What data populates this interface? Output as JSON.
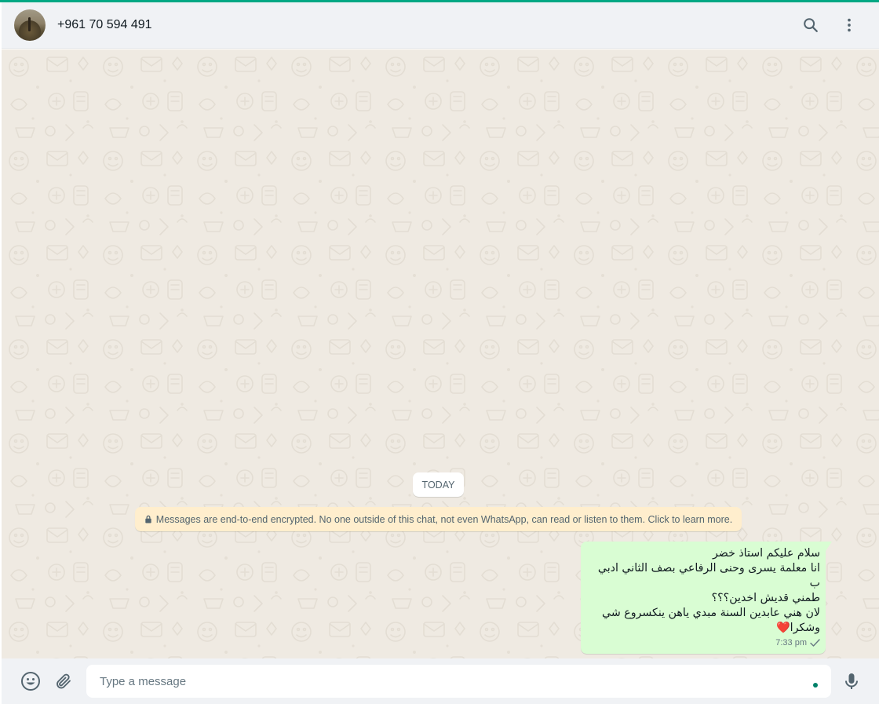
{
  "header": {
    "contact_name": "+961 70 594 491",
    "search_icon": "search-icon",
    "menu_icon": "more-vertical-icon"
  },
  "chat": {
    "date_chip": "TODAY",
    "encryption_notice": "Messages are end-to-end encrypted. No one outside of this chat, not even WhatsApp, can read or listen to them. Click to learn more.",
    "messages": [
      {
        "direction": "outgoing",
        "text": "سلام عليكم استاذ  خضر\nانا معلمة يسرى وحنى الرفاعي بصف الثاني ادبي ب\nطمني قديش اخدين؟؟؟\nلان هني عابدين السنة مبدي ياهن ينكسروع شي\nوشكرا",
        "emoji": "❤️",
        "time": "7:33 pm",
        "status": "sent"
      }
    ]
  },
  "composer": {
    "placeholder": "Type a message",
    "emoji_icon": "emoji-icon",
    "attach_icon": "paperclip-icon",
    "mic_icon": "mic-icon"
  },
  "colors": {
    "accent": "#00a884",
    "outgoing_bubble": "#d9fdd3",
    "notice_bg": "#ffeecd",
    "chat_bg": "#efeae2"
  }
}
